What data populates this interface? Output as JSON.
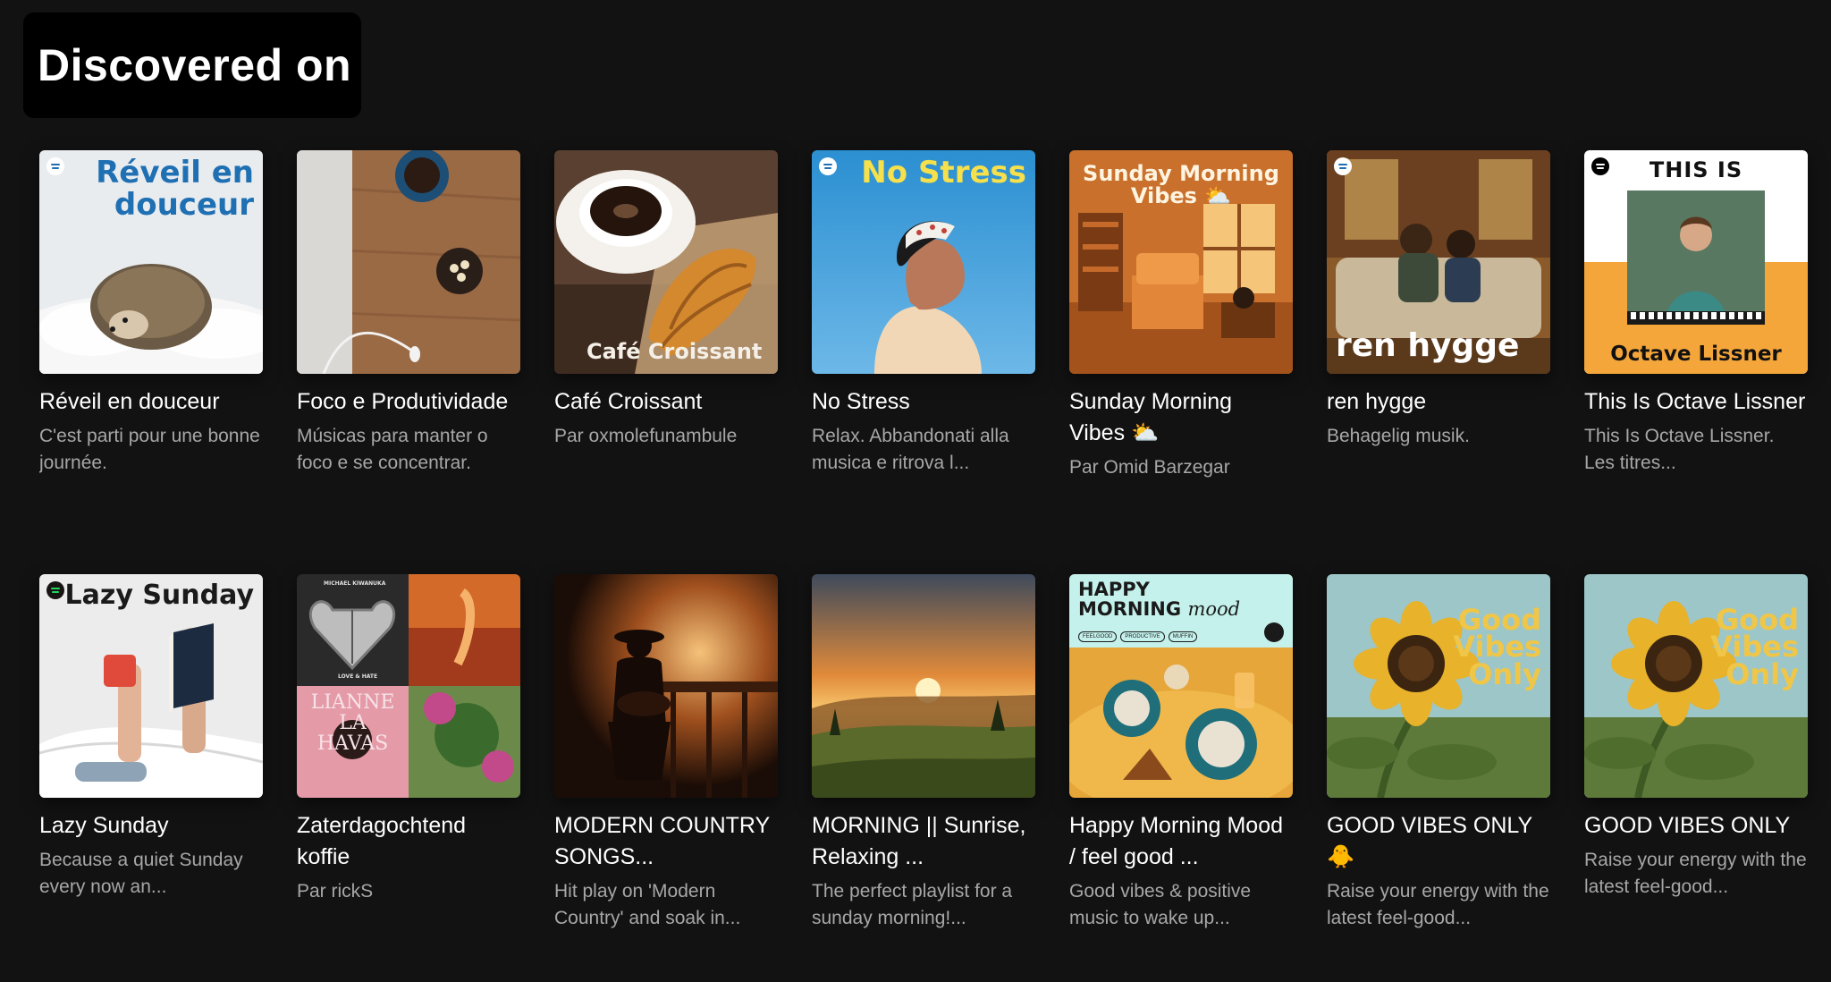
{
  "section": {
    "title": "Discovered on"
  },
  "colors": {
    "background": "#121212",
    "heading_box": "#000000",
    "title": "#ffffff",
    "subtitle": "#a7a7a7"
  },
  "cards": [
    {
      "title": "Réveil en douceur",
      "subtitle": "C'est parti pour une bonne journée.",
      "cover_text": "Réveil en douceur",
      "cover_line1": "Réveil en",
      "cover_line2": "douceur",
      "icon": "hedgehog-image"
    },
    {
      "title": "Foco e Produtividade",
      "subtitle": "Músicas para manter o foco e se concentrar.",
      "icon": "desk-coffee-image"
    },
    {
      "title": "Café Croissant",
      "subtitle": "Par oxmolefunambule",
      "cover_text": "Café Croissant",
      "icon": "coffee-croissant-image"
    },
    {
      "title": "No Stress",
      "subtitle": "Relax. Abbandonati alla musica e ritrova l...",
      "cover_text": "No Stress",
      "icon": "woman-sky-image"
    },
    {
      "title": "Sunday Morning Vibes ⛅",
      "subtitle": "Par Omid Barzegar",
      "cover_line1": "Sunday Morning",
      "cover_line2": "Vibes ⛅",
      "icon": "cozy-room-image"
    },
    {
      "title": "ren hygge",
      "subtitle": "Behagelig musik.",
      "cover_text": "ren hygge",
      "icon": "couple-couch-image"
    },
    {
      "title": "This Is Octave Lissner",
      "subtitle": "This Is Octave Lissner. Les titres...",
      "cover_line1": "THIS IS",
      "cover_line2": "Octave Lissner",
      "icon": "artist-piano-image"
    },
    {
      "title": "Lazy Sunday",
      "subtitle": "Because a quiet Sunday every now an...",
      "cover_text": "Lazy Sunday",
      "icon": "bed-book-mug-image"
    },
    {
      "title": "Zaterdagochtend koffie",
      "subtitle": "Par rickS",
      "collage_top": "MICHAEL KIWANUKA",
      "collage_sub": "LOVE & HATE",
      "collage_name1": "LIANNE",
      "collage_name2": "LA",
      "collage_name3": "HAVAS",
      "icon": "album-collage-image"
    },
    {
      "title": "MODERN COUNTRY SONGS...",
      "subtitle": "Hit play on 'Modern Country' and soak in...",
      "icon": "guitarist-bar-image"
    },
    {
      "title": "MORNING || Sunrise, Relaxing ...",
      "subtitle": "The perfect playlist for a sunday morning!...",
      "icon": "sunrise-landscape-image"
    },
    {
      "title": "Happy Morning Mood / feel good ...",
      "subtitle": "Good vibes & positive music to wake up...",
      "cover_line1": "HAPPY",
      "cover_line2": "MORNING",
      "cover_line3": "mood",
      "tags": [
        "FEELGOOD",
        "PRODUCTIVE",
        "MUFFIN"
      ],
      "icon": "breakfast-table-image"
    },
    {
      "title": "GOOD VIBES ONLY 🐥",
      "subtitle": "Raise your energy with the latest feel-good...",
      "cover_line1": "Good",
      "cover_line2": "Vibes",
      "cover_line3": "Only",
      "icon": "sunflower-image"
    },
    {
      "title": "GOOD VIBES ONLY",
      "subtitle": "Raise your energy with the latest feel-good...",
      "cover_line1": "Good",
      "cover_line2": "Vibes",
      "cover_line3": "Only",
      "icon": "sunflower-image"
    }
  ]
}
